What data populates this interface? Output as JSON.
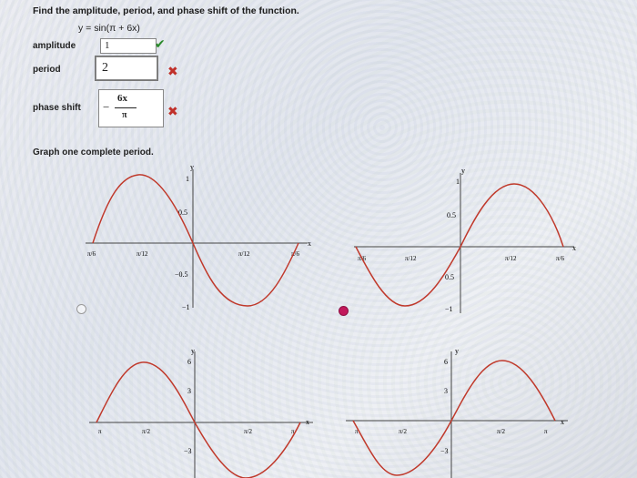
{
  "question": "Find the amplitude, period, and phase shift of the function.",
  "equation": "y = sin(π + 6x)",
  "amplitude": {
    "label": "amplitude",
    "value": "1",
    "status": "correct"
  },
  "period": {
    "label": "period",
    "value": "2",
    "status": "incorrect"
  },
  "phase_shift": {
    "label": "phase shift",
    "numerator": "6x",
    "denominator": "π",
    "prefix": "−",
    "status": "incorrect"
  },
  "graph_prompt": "Graph one complete period.",
  "graphs": {
    "top_left": {
      "axis_x": "x",
      "axis_y": "y",
      "y_ticks": [
        "1",
        "0.5",
        "−0.5",
        "−1"
      ],
      "x_ticks": [
        "π/6",
        "π/12",
        "π/12",
        "π/6"
      ]
    },
    "top_right": {
      "axis_x": "x",
      "axis_y": "y",
      "y_ticks": [
        "1",
        "0.5",
        "0.5",
        "−1"
      ],
      "x_ticks": [
        "π/6",
        "π/12",
        "π/12",
        "π/6"
      ]
    },
    "bottom_left": {
      "axis_x": "x",
      "axis_y": "y",
      "y_ticks": [
        "6",
        "3",
        "−3"
      ],
      "x_ticks": [
        "π",
        "π/2",
        "π/2",
        "π"
      ]
    },
    "bottom_right": {
      "axis_x": "x",
      "axis_y": "y",
      "y_ticks": [
        "6",
        "3",
        "−3"
      ],
      "x_ticks": [
        "π",
        "π/2",
        "π/2",
        "π"
      ]
    }
  },
  "colors": {
    "curve": "#c0392b",
    "check": "#2a8a2a",
    "cross": "#c0302a",
    "radio_selected": "#c2185b"
  }
}
